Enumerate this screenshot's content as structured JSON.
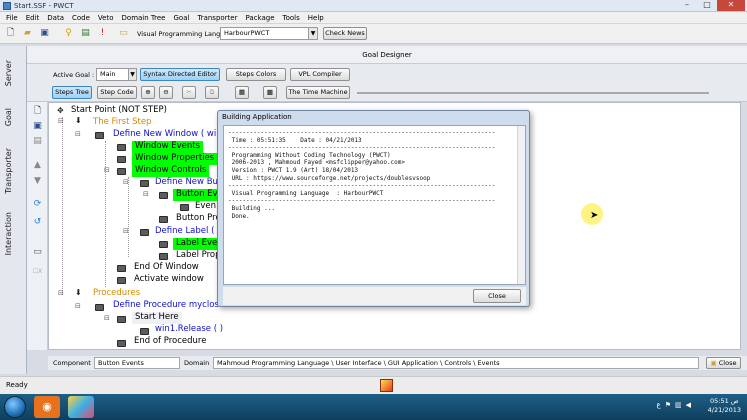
{
  "window": {
    "title": "Start.SSF - PWCT"
  },
  "menu": [
    "File",
    "Edit",
    "Data",
    "Code",
    "Veto",
    "Domain Tree",
    "Goal",
    "Transporter",
    "Package",
    "Tools",
    "Help"
  ],
  "toolbar": {
    "vpl_label": "Visual Programming Language",
    "vpl_value": "HarbourPWCT",
    "check_news": "Check News"
  },
  "sidebar_tabs": [
    "Server",
    "Goal",
    "Transporter",
    "Interaction"
  ],
  "designer": {
    "header": "Goal Designer",
    "active_goal_label": "Active Goal :",
    "active_goal_value": "Main",
    "syntax_editor": "Syntax Directed Editor",
    "steps_colors": "Steps Colors",
    "vpl_compiler": "VPL Compiler",
    "steps_tree": "Steps Tree",
    "step_code": "Step Code",
    "time_machine": "The Time Machine"
  },
  "tree": [
    "Start Point (NOT STEP)",
    "The First Step",
    "Define New Window  ( win",
    "Window Events",
    "Window Properties",
    "Window Controls",
    "Define New Butt",
    "Button Eve",
    "Even",
    "Button Pro",
    "Define Label ( l",
    "Label Even",
    "Label Prop",
    "End Of Window",
    "Activate window",
    "Procedures",
    "Define Procedure myclose",
    "Start Here",
    "win1.Release ( )",
    "End of Procedure"
  ],
  "dialog": {
    "title": "Building Application",
    "log": "--------------------------------------------------------------------------\n Time : 05:51:35    Date : 04/21/2013\n--------------------------------------------------------------------------\n Programming Without Coding Technology (PWCT)\n 2006-2013 , Mahmoud Fayed <msfclipper@yahoo.com>\n Version : PWCT 1.9 (Art) 18/04/2013\n URL : https://www.sourceforge.net/projects/doublesvsoop\n--------------------------------------------------------------------------\n Visual Programming Language  : HarbourPWCT\n--------------------------------------------------------------------------\n Building ...\n Done.",
    "close": "Close"
  },
  "status": {
    "component_label": "Component",
    "component_value": "Button Events",
    "domain_label": "Domain",
    "domain_value": "Mahmoud Programming Language \\ User Interface \\ GUI Application \\ Controls \\ Events",
    "close": "Close"
  },
  "ready": "Ready",
  "taskbar": {
    "lang": "ع",
    "time": "05:51 ص",
    "date": "4/21/2013"
  }
}
